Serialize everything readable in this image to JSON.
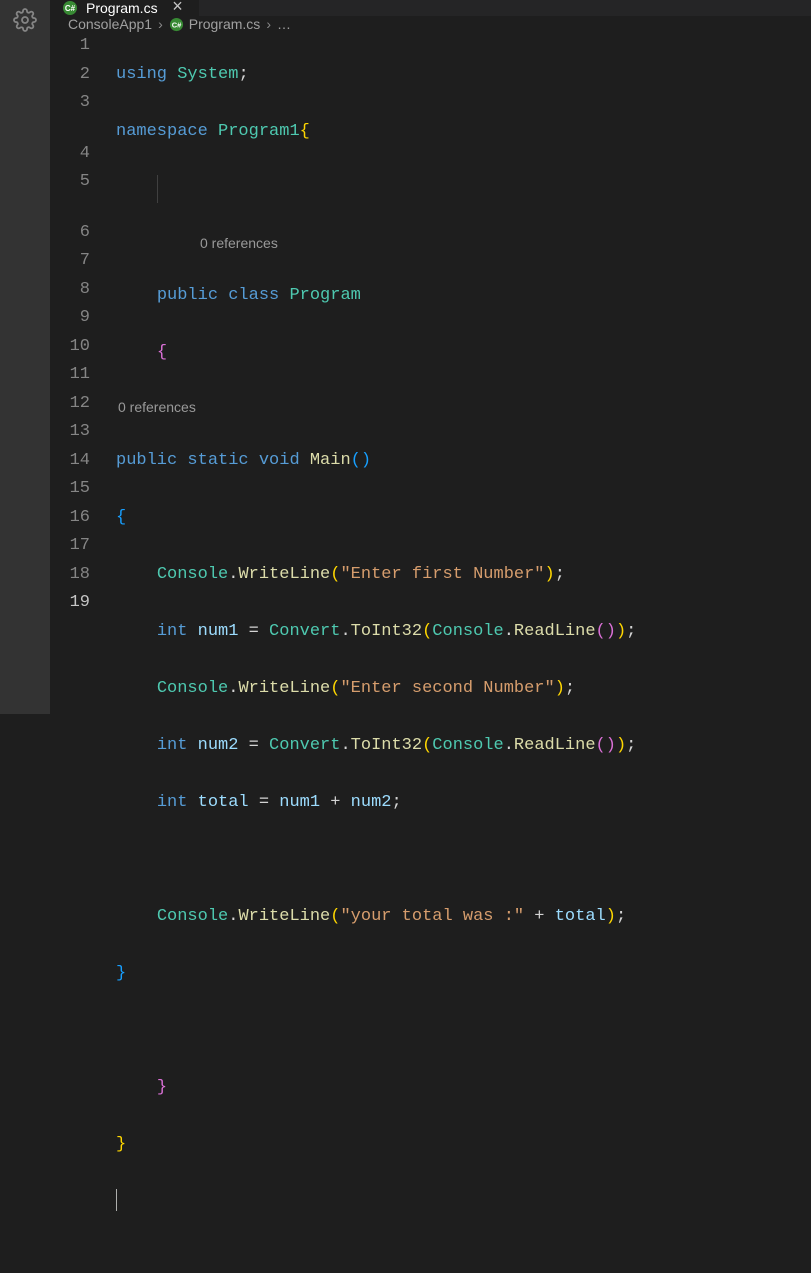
{
  "tab": {
    "label": "Program.cs",
    "close_glyph": "×"
  },
  "breadcrumbs": {
    "item1": "ConsoleApp1",
    "item2": "Program.cs",
    "item3": "…",
    "sep": "›"
  },
  "codelens": {
    "refs0a": "0 references",
    "refs0b": "0 references"
  },
  "lines": {
    "l1": "1",
    "l2": "2",
    "l3": "3",
    "l4": "4",
    "l5": "5",
    "l6": "6",
    "l7": "7",
    "l8": "8",
    "l9": "9",
    "l10": "10",
    "l11": "11",
    "l12": "12",
    "l13": "13",
    "l14": "14",
    "l15": "15",
    "l16": "16",
    "l17": "17",
    "l18": "18",
    "l19": "19"
  },
  "code": {
    "using": "using",
    "system": "System",
    "namespace": "namespace",
    "program1": "Program1",
    "public": "public",
    "class": "class",
    "program": "Program",
    "static": "static",
    "void": "void",
    "main": "Main",
    "int": "int",
    "console": "Console",
    "writeline": "WriteLine",
    "convert": "Convert",
    "toint32": "ToInt32",
    "readline": "ReadLine",
    "num1": "num1",
    "num2": "num2",
    "total": "total",
    "str1": "\"Enter first Number\"",
    "str2": "\"Enter second Number\"",
    "str3": "\"your total was :\"",
    "semi": ";",
    "open_b": "{",
    "close_b": "}",
    "open_p": "(",
    "close_p": ")",
    "eq": " = ",
    "plus": " + ",
    "dot": ".",
    "comma": ","
  }
}
